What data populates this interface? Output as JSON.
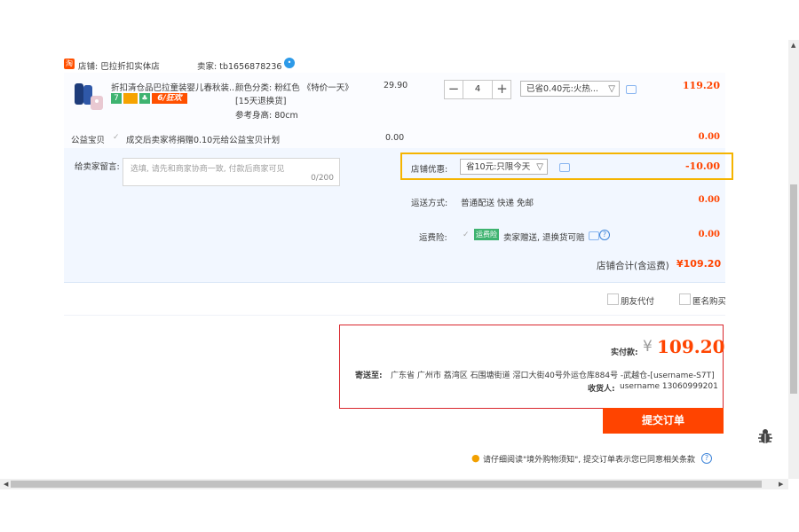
{
  "shop": {
    "badge": "淘",
    "label": "店铺: 巴拉折扣实体店",
    "seller_label": "卖家: tb1656878236",
    "chat_icon": "chat-bubble-icon"
  },
  "item": {
    "title": "折扣清仓品巴拉童装婴儿春秋装...",
    "badge_seven": "7",
    "badge_61": "6/狂欢",
    "spec_color": "颜色分类: 粉红色 《特价一天》",
    "spec_return": "[15天退换货]",
    "spec_height": "参考身高: 80cm",
    "price": "29.90",
    "qty": "4",
    "minus": "−",
    "plus": "+",
    "discount_select": "已省0.40元:火热...",
    "subtotal": "119.20"
  },
  "charity": {
    "label": "公益宝贝",
    "text": "成交后卖家将捐赠0.10元给公益宝贝计划",
    "price": "0.00",
    "amount": "0.00"
  },
  "message": {
    "label": "给卖家留言:",
    "placeholder": "选填, 请先和商家协商一致, 付款后商家可见",
    "counter": "0/200"
  },
  "promo": {
    "label": "店铺优惠:",
    "select": "省10元:只限今天",
    "amount": "-10.00",
    "highlight_color": "#f5b400"
  },
  "shipping": {
    "label": "运送方式:",
    "value": "普通配送 快递 免邮",
    "amount": "0.00"
  },
  "insurance": {
    "label": "运费险:",
    "tag": "运费险",
    "text": "卖家赠送, 退换货可赔",
    "amount": "0.00"
  },
  "shop_total": {
    "label": "店铺合计(含运费)",
    "amount": "¥109.20"
  },
  "options": {
    "friend_pay": "朋友代付",
    "anonymous": "匿名购买"
  },
  "summary": {
    "pay_label": "实付款:",
    "currency": "¥",
    "pay_amount": "109.20",
    "address_label": "寄送至:",
    "address": "广东省 广州市 荔湾区 石围塘街道 滘口大街40号外运仓库884号 -武越仓-[username-S7T]",
    "receiver_label": "收货人:",
    "receiver": "username 13060999201",
    "border_color": "#d9262c"
  },
  "submit_button": "提交订单",
  "notice": "请仔细阅读\"境外购物须知\", 提交订单表示您已同意相关条款",
  "accent_color": "#ff4400"
}
